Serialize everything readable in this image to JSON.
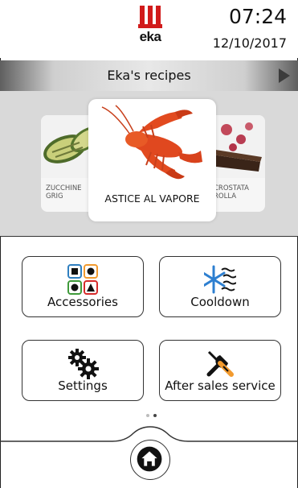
{
  "header": {
    "logo_text": "eka",
    "time": "07:24",
    "date": "12/10/2017"
  },
  "recipes": {
    "title": "Eka's recipes",
    "items": [
      {
        "label": "ZUCCHINE GRIG"
      },
      {
        "label": "ASTICE AL VAPORE"
      },
      {
        "label": "CROSTATA ROLLA"
      }
    ]
  },
  "menu": {
    "accessories": "Accessories",
    "cooldown": "Cooldown",
    "settings": "Settings",
    "after_sales": "After sales service"
  },
  "pager": {
    "pages": 2,
    "current": 2
  },
  "colors": {
    "brand_red": "#d11b1b",
    "accessory_blue": "#2f7fc0",
    "accessory_orange": "#f29a2e",
    "accessory_green": "#3f9a3a",
    "accessory_red": "#d62b2b",
    "cooldown_blue": "#2d7fd0"
  },
  "icons": {
    "accessories": "accessories-grid-icon",
    "cooldown": "snowflake-icon",
    "settings": "gears-icon",
    "after_sales": "tools-icon",
    "home": "home-icon",
    "next": "arrow-right-icon"
  }
}
